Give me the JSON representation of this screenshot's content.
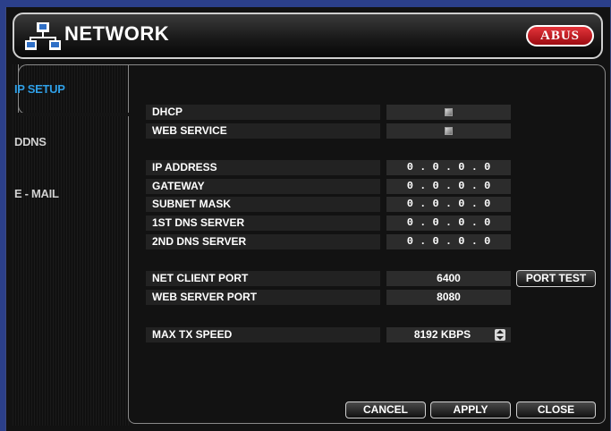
{
  "header": {
    "title": "NETWORK",
    "brand": "ABUS"
  },
  "tabs": [
    {
      "label": "IP SETUP",
      "active": true
    },
    {
      "label": "DDNS",
      "active": false
    },
    {
      "label": "E - MAIL",
      "active": false
    }
  ],
  "settings": {
    "dhcp": {
      "label": "DHCP"
    },
    "web_service": {
      "label": "WEB SERVICE"
    },
    "ip_address": {
      "label": "IP ADDRESS",
      "value": "0 . 0 . 0 . 0"
    },
    "gateway": {
      "label": "GATEWAY",
      "value": "0 . 0 . 0 . 0"
    },
    "subnet_mask": {
      "label": "SUBNET MASK",
      "value": "0 . 0 . 0 . 0"
    },
    "dns1": {
      "label": "1ST DNS SERVER",
      "value": "0 . 0 . 0 . 0"
    },
    "dns2": {
      "label": "2ND DNS SERVER",
      "value": "0 . 0 . 0 . 0"
    },
    "net_client_port": {
      "label": "NET CLIENT PORT",
      "value": "6400"
    },
    "web_server_port": {
      "label": "WEB SERVER PORT",
      "value": "8080"
    },
    "max_tx_speed": {
      "label": "MAX TX SPEED",
      "value": "8192 KBPS"
    }
  },
  "buttons": {
    "port_test": "PORT TEST",
    "cancel": "CANCEL",
    "apply": "APPLY",
    "close": "CLOSE"
  },
  "colors": {
    "accent": "#2f9fe6",
    "brand_red": "#d0242a",
    "background": "#121212"
  }
}
